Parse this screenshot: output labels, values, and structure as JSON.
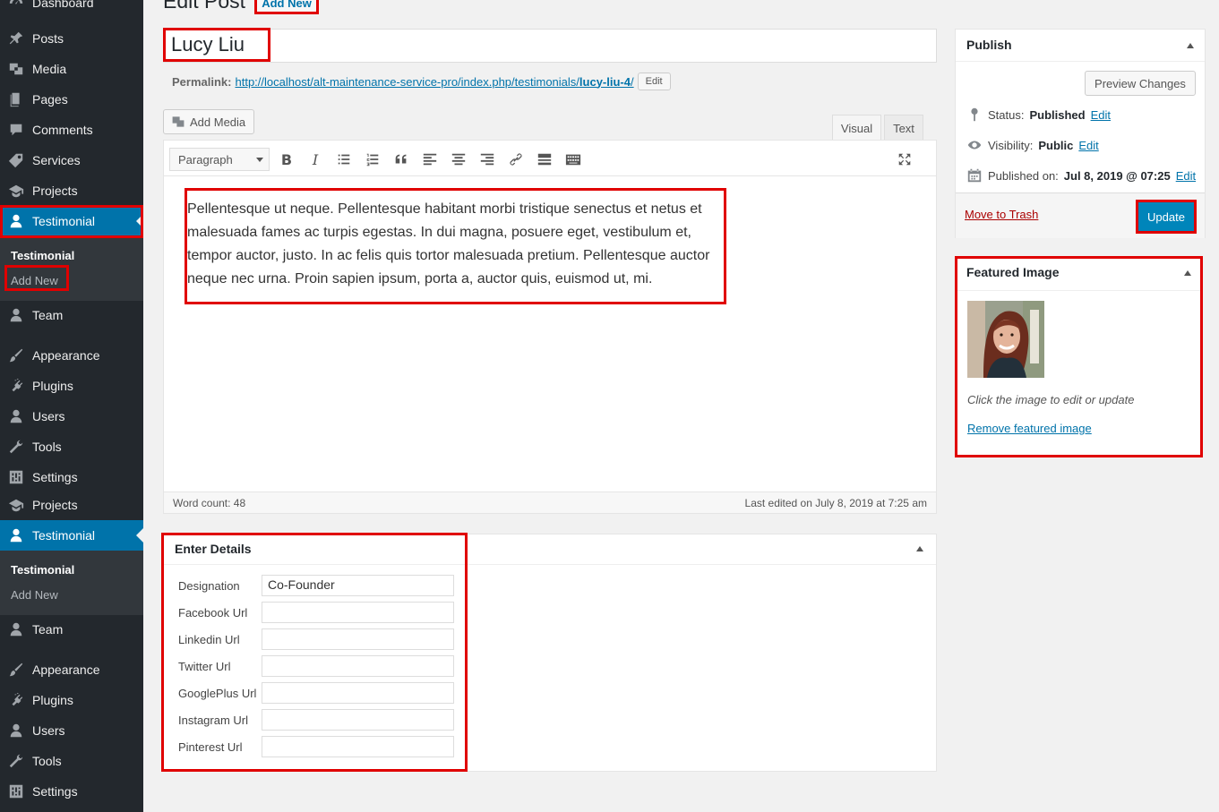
{
  "sidebar": {
    "items": [
      {
        "label": "Dashboard"
      },
      {
        "label": "Posts"
      },
      {
        "label": "Media"
      },
      {
        "label": "Pages"
      },
      {
        "label": "Comments"
      },
      {
        "label": "Services"
      },
      {
        "label": "Projects"
      },
      {
        "label": "Testimonial"
      },
      {
        "label": "Team"
      },
      {
        "label": "Appearance"
      },
      {
        "label": "Plugins"
      },
      {
        "label": "Users"
      },
      {
        "label": "Tools"
      },
      {
        "label": "Settings"
      },
      {
        "label": "Projects"
      },
      {
        "label": "Testimonial"
      },
      {
        "label": "Team"
      },
      {
        "label": "Appearance"
      },
      {
        "label": "Plugins"
      },
      {
        "label": "Users"
      },
      {
        "label": "Tools"
      },
      {
        "label": "Settings"
      }
    ],
    "submenu1": {
      "title": "Testimonial",
      "add_new": "Add New"
    },
    "submenu2": {
      "title": "Testimonial",
      "add_new": "Add New"
    }
  },
  "header": {
    "title": "Edit Post",
    "add_new": "Add New"
  },
  "post": {
    "title": "Lucy Liu",
    "permalink_label": "Permalink:",
    "permalink_base": "http://localhost/alt-maintenance-service-pro/index.php/testimonials/",
    "permalink_slug": "lucy-liu-4",
    "permalink_end": "/",
    "permalink_edit": "Edit"
  },
  "editor": {
    "add_media": "Add Media",
    "tab_visual": "Visual",
    "tab_text": "Text",
    "format": "Paragraph",
    "content": "Pellentesque ut neque. Pellentesque habitant morbi tristique senectus et netus et malesuada fames ac turpis egestas. In dui magna, posuere eget, vestibulum et, tempor auctor, justo. In ac felis quis tortor malesuada pretium. Pellentesque auctor neque nec urna. Proin sapien ipsum, porta a, auctor quis, euismod ut, mi.",
    "word_count": "Word count: 48",
    "last_edited": "Last edited on July 8, 2019 at 7:25 am"
  },
  "details": {
    "title": "Enter Details",
    "fields": [
      {
        "label": "Designation",
        "value": "Co-Founder"
      },
      {
        "label": "Facebook Url",
        "value": ""
      },
      {
        "label": "Linkedin Url",
        "value": ""
      },
      {
        "label": "Twitter Url",
        "value": ""
      },
      {
        "label": "GooglePlus Url",
        "value": ""
      },
      {
        "label": "Instagram Url",
        "value": ""
      },
      {
        "label": "Pinterest Url",
        "value": ""
      }
    ]
  },
  "publish": {
    "title": "Publish",
    "preview": "Preview Changes",
    "status_label": "Status:",
    "status_value": "Published",
    "visibility_label": "Visibility:",
    "visibility_value": "Public",
    "published_label": "Published on:",
    "published_value": "Jul 8, 2019 @ 07:25",
    "edit": "Edit",
    "trash": "Move to Trash",
    "update": "Update"
  },
  "featured": {
    "title": "Featured Image",
    "hint": "Click the image to edit or update",
    "remove": "Remove featured image"
  },
  "colors": {
    "accent": "#0073aa",
    "sidebar": "#23282d",
    "highlight": "#e00000"
  }
}
